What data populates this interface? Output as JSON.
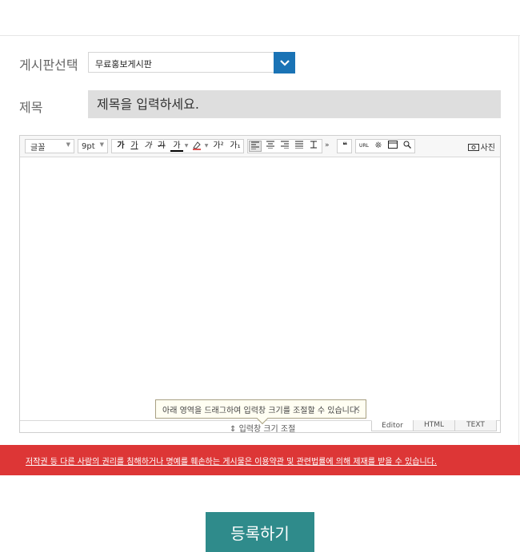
{
  "form": {
    "board_label": "게시판선택",
    "board_value": "무료홍보게시판",
    "title_label": "제목",
    "title_placeholder": "제목을 입력하세요."
  },
  "editor": {
    "font_label": "글꼴",
    "size_label": "9pt",
    "format_buttons": [
      "가",
      "가",
      "가",
      "가",
      "가",
      "가",
      "가²",
      "가₁"
    ],
    "url_label": "URL",
    "photo_label": "사진",
    "tooltip": "아래 영역을 드래그하여 입력창 크기를 조절할 수 있습니다.",
    "resize_label": "입력창 크기 조절",
    "tabs": [
      "Editor",
      "HTML",
      "TEXT"
    ]
  },
  "notice": {
    "text": "저작권 등 다른 사람의 권리를 침해하거나 명예를 훼손하는 게시물은 이용약관 및 관련법률에 의해 제재를 받을 수 있습니다."
  },
  "actions": {
    "submit_label": "등록하기"
  },
  "colors": {
    "accent_blue": "#1a73b5",
    "notice_red": "#dd3636",
    "submit_teal": "#2f8b8b"
  }
}
